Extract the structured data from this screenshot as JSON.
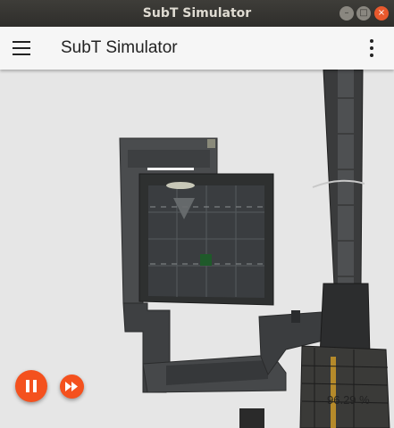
{
  "window": {
    "title": "SubT Simulator",
    "minimize_glyph": "–",
    "maximize_glyph": "□",
    "close_glyph": "×"
  },
  "appbar": {
    "title": "SubT Simulator",
    "menu_icon": "hamburger-menu-icon",
    "more_icon": "more-vert-icon"
  },
  "controls": {
    "play_pause_icon": "pause-icon",
    "step_icon": "fast-forward-icon"
  },
  "status": {
    "real_time_factor": "96.29 %"
  },
  "colors": {
    "titlebar": "#3c3b37",
    "close_button": "#e9592d",
    "appbar": "#f6f6f6",
    "accent": "#f4511e",
    "scene_background": "#e6e6e6"
  }
}
